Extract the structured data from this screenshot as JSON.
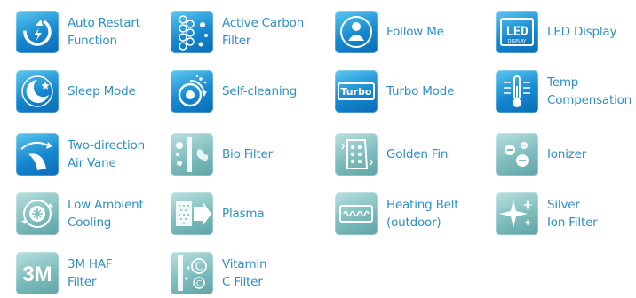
{
  "colors": {
    "label_text": "#2f8fc6",
    "icon_blue": "#1688d0",
    "icon_teal": "#7fbdbd"
  },
  "features": [
    {
      "label": "Auto Restart\nFunction",
      "icon": "power-cycle-icon"
    },
    {
      "label": "Active Carbon\nFilter",
      "icon": "carbon-hexagons-icon"
    },
    {
      "label": "Follow Me",
      "icon": "person-icon"
    },
    {
      "label": "LED Display",
      "icon": "led-display-icon",
      "icon_text": "LED",
      "icon_subtext": "DISPLAY"
    },
    {
      "label": "Sleep Mode",
      "icon": "moon-star-icon"
    },
    {
      "label": "Self-cleaning",
      "icon": "self-clean-fan-icon"
    },
    {
      "label": "Turbo Mode",
      "icon": "turbo-icon",
      "icon_text": "Turbo"
    },
    {
      "label": "Temp\nCompensation",
      "icon": "thermometer-icon"
    },
    {
      "label": "Two-direction\nAir Vane",
      "icon": "air-vane-icon"
    },
    {
      "label": "Bio Filter",
      "icon": "bio-filter-icon"
    },
    {
      "label": "Golden Fin",
      "icon": "golden-fin-icon"
    },
    {
      "label": "Ionizer",
      "icon": "ionizer-icon"
    },
    {
      "label": "Low Ambient\nCooling",
      "icon": "low-ambient-icon"
    },
    {
      "label": "Plasma",
      "icon": "plasma-icon"
    },
    {
      "label": "Heating Belt\n(outdoor)",
      "icon": "heating-belt-icon"
    },
    {
      "label": "Silver\nIon Filter",
      "icon": "silver-ion-icon"
    },
    {
      "label": "3M HAF\nFilter",
      "icon": "3m-logo-icon",
      "icon_text": "3M"
    },
    {
      "label": "Vitamin\nC Filter",
      "icon": "vitamin-c-icon",
      "icon_text": "C"
    }
  ]
}
